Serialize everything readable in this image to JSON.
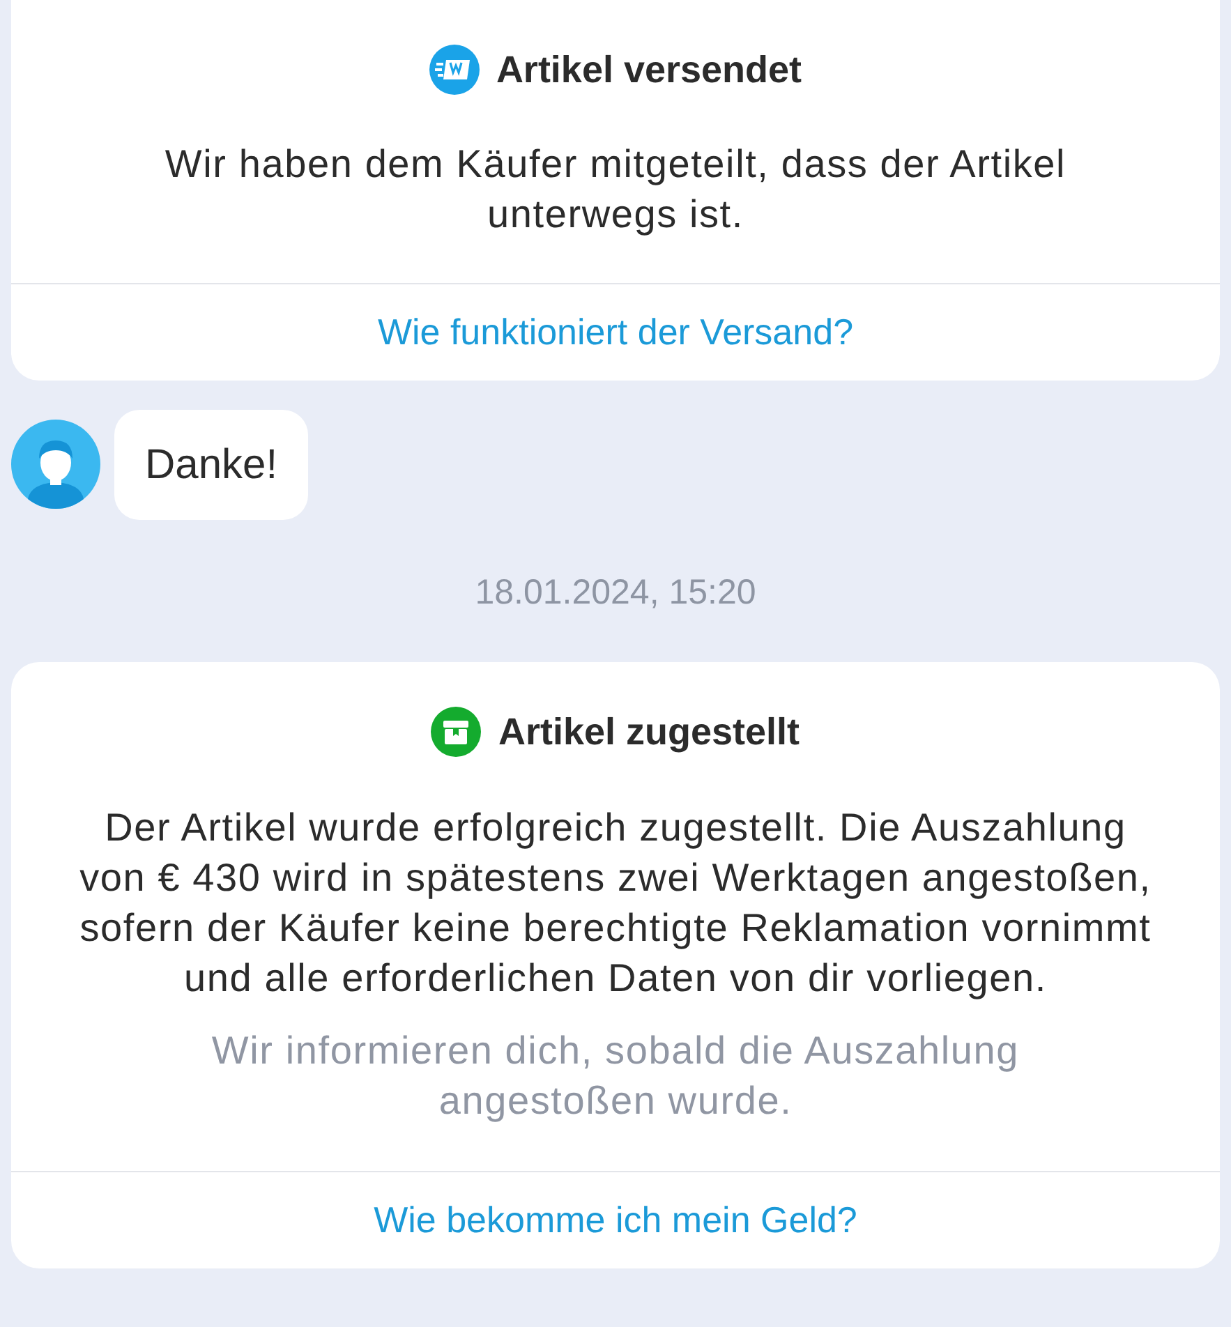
{
  "messages": [
    {
      "kind": "shipped",
      "title": "Artikel versendet",
      "color": "#1aa3e8",
      "body": "Wir haben dem Käufer mitgeteilt, dass der Artikel unterwegs ist.",
      "link": "Wie funktioniert der Versand?"
    },
    {
      "kind": "bubble",
      "text": "Danke!"
    },
    {
      "kind": "timestamp",
      "text": "18.01.2024, 15:20"
    },
    {
      "kind": "delivered",
      "title": "Artikel zugestellt",
      "color": "#14ab2e",
      "body": "Der Artikel wurde erfolgreich zugestellt. Die Auszahlung von € 430 wird in spätestens zwei Werktagen angestoßen, sofern der Käufer keine berechtigte Reklamation vornimmt und alle erforderlichen Daten von dir vorliegen.",
      "note": "Wir informieren dich, sobald die Auszahlung angestoßen wurde.",
      "link": "Wie bekomme ich mein Geld?"
    }
  ]
}
